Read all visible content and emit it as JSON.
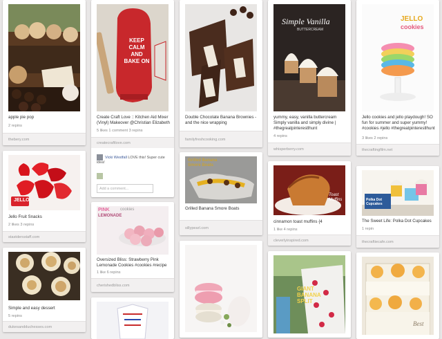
{
  "pins": {
    "apple": {
      "description": "apple pie pop",
      "stats": "2 repins",
      "source": "thebery.com"
    },
    "keepcalm": {
      "description": "Create Craft Love :: Kitchen Aid Mixer (Vinyl) Makeover @Christian Elizabeth",
      "stats": "5 likes   1 comment   3 repins",
      "source": "createcraftlove.com",
      "image_text": "KEEP CALM AND BAKE ON",
      "comment_author": "Vicki Westfall",
      "comment_text": "LOVE this! Super cute idea!",
      "comment_placeholder": "Add a comment..."
    },
    "brownies": {
      "description": "Double Chocolate Banana Brownies - and the nice wrapping",
      "source": "familyfreshcooking.com"
    },
    "vanilla": {
      "description": "yummy, easy, vanilla buttercream Simply vanilla and simply divine | #thegreatpinterestlhunt",
      "stats": "4 repins",
      "source": "whisperberry.com",
      "image_title": "Simple Vanilla",
      "image_subtitle": "BUTTERCREAM"
    },
    "jellocookies": {
      "description": "Jello cookies and jello playdough! SO fun for summer and super yummy! #cookies #jello #thegreatpinterestlhunt",
      "stats": "3 likes   2 repins",
      "source": "thecraftingfilm.net",
      "image_line1": "JELLO",
      "image_line2": "cookies"
    },
    "jellofruit": {
      "description": "Jello Fruit Snacks",
      "stats": "2 likes   3 repins",
      "source": "stastdersstaff.com",
      "image_brand": "JELLO"
    },
    "banana_smores": {
      "description": "Grilled Banana Smore Boats",
      "source": "sillypearl.com",
      "image_text": "Grilled Banana Smore Boats"
    },
    "muffin": {
      "description": "cinnamon toast muffins {4",
      "stats": "1 like   4 repins",
      "source": "cleverlyinspired.com",
      "image_text": "Toast Muffins"
    },
    "cupcakes": {
      "description": "The Sweet Life: Polka Dot Cupcakes",
      "stats": "1 repin",
      "source": "thecraftiecafe.com",
      "image_text": "Polka Dot Cupcakes"
    },
    "pinklemonade": {
      "description": "Oversized Bliss: Strawberry Pink Lemonade Cookies #cookies #recipe",
      "stats": "1 like   6 repins",
      "source": "cherishedbliss.com",
      "image_line1": "PINK",
      "image_line2": "LEMONADE",
      "image_line3": "cookies"
    },
    "dessert": {
      "description": "Simple and easy dessert",
      "stats": "5 repins",
      "source": "dukesandduchesses.com"
    },
    "giant_banana": {
      "image_line1": "GIANT",
      "image_line2": "BANANA",
      "image_line3": "SPLIT"
    },
    "trifle": {
      "image_text": "Best"
    }
  },
  "colors": {
    "background": "#e9e7e7",
    "card": "#ffffff",
    "source_bar": "#f2f0f0",
    "keepcalm_red": "#c8282c",
    "jello_red": "#e0222b"
  },
  "icons": [
    "avatar-icon"
  ]
}
